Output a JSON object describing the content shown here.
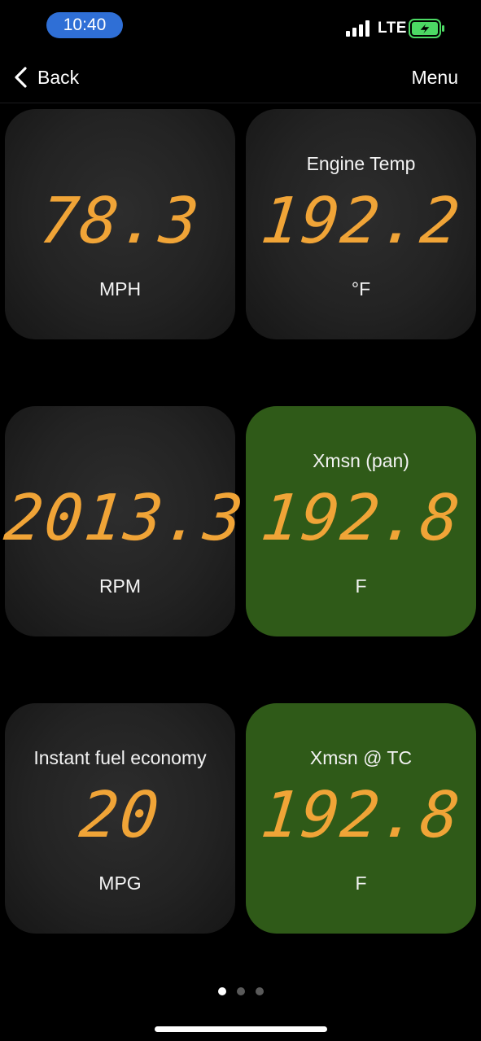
{
  "status_bar": {
    "time": "10:40",
    "network": "LTE",
    "accent_color": "#2f6fd6",
    "battery_color": "#4cd964"
  },
  "nav": {
    "back_label": "Back",
    "menu_label": "Menu"
  },
  "tiles": [
    {
      "label": "",
      "value": "78.3",
      "unit": "MPH",
      "state": "normal"
    },
    {
      "label": "Engine Temp",
      "value": "192.2",
      "unit": "°F",
      "state": "normal"
    },
    {
      "label": "",
      "value": "2013.3",
      "unit": "RPM",
      "state": "normal"
    },
    {
      "label": "Xmsn (pan)",
      "value": "192.8",
      "unit": "F",
      "state": "alert"
    },
    {
      "label": "Instant fuel economy",
      "value": "20",
      "unit": "MPG",
      "state": "normal"
    },
    {
      "label": "Xmsn @ TC",
      "value": "192.8",
      "unit": "F",
      "state": "alert"
    }
  ],
  "colors": {
    "value": "#f0a437",
    "tile_normal": "#232323",
    "tile_alert": "#2f5a18"
  },
  "pager": {
    "pages": 3,
    "current": 1
  }
}
